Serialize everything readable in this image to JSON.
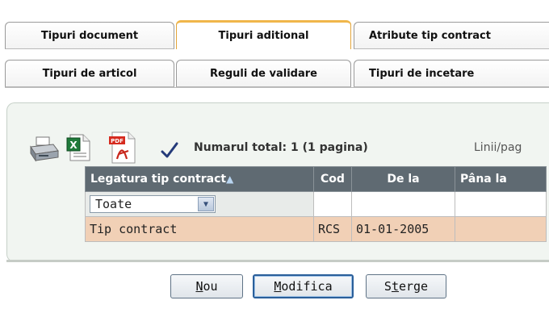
{
  "tabs_row1": [
    {
      "label": "Tipuri document",
      "active": false
    },
    {
      "label": "Tipuri aditional",
      "active": true
    },
    {
      "label": "Atribute tip contract",
      "active": false
    }
  ],
  "tabs_row2": [
    {
      "label": "Tipuri de articol"
    },
    {
      "label": "Reguli de validare"
    },
    {
      "label": "Tipuri de incetare"
    }
  ],
  "toolbar": {
    "icons": [
      "printer-icon",
      "excel-export-icon",
      "pdf-export-icon",
      "checkmark-icon"
    ],
    "summary": "Numarul total: 1 (1 pagina)",
    "lines_label": "Linii/pag"
  },
  "grid": {
    "columns": [
      "Legatura tip contract",
      "Cod",
      "De la",
      "Pâna la"
    ],
    "sort_indicator": "▲",
    "filter": {
      "selected": "Toate"
    },
    "rows": [
      {
        "legatura": "Tip contract",
        "cod": "RCS",
        "de_la": "01-01-2005",
        "pana_la": ""
      }
    ]
  },
  "buttons": {
    "new": {
      "accesskey": "N",
      "rest": "ou"
    },
    "modify": {
      "accesskey": "M",
      "rest": "odifica"
    },
    "delete": {
      "pre": "S",
      "accesskey": "t",
      "rest": "erge"
    }
  },
  "colors": {
    "active_tab_accent": "#f0b64a",
    "header_bg": "#5f6a72",
    "row_bg": "#f1d0b6",
    "panel_bg": "#f1f5f1"
  }
}
